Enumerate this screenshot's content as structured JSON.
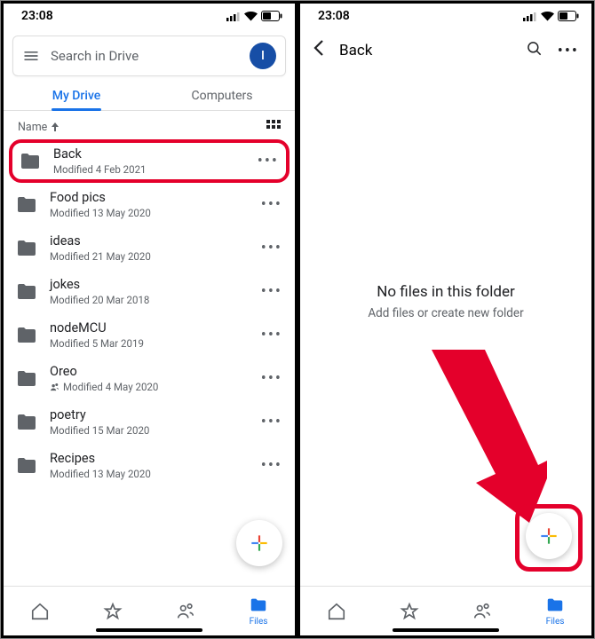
{
  "status": {
    "time": "23:08"
  },
  "left": {
    "search_placeholder": "Search in Drive",
    "avatar_initial": "I",
    "tabs": {
      "my_drive": "My Drive",
      "computers": "Computers"
    },
    "sort_label": "Name",
    "items": [
      {
        "name": "Back",
        "meta": "Modified 4 Feb 2021",
        "shared": false,
        "highlight": true
      },
      {
        "name": "Food pics",
        "meta": "Modified 13 May 2020",
        "shared": false
      },
      {
        "name": "ideas",
        "meta": "Modified 21 May 2020",
        "shared": false
      },
      {
        "name": "jokes",
        "meta": "Modified 20 Mar 2018",
        "shared": false
      },
      {
        "name": "nodeMCU",
        "meta": "Modified 5 Mar 2019",
        "shared": false
      },
      {
        "name": "Oreo",
        "meta": "Modified 4 May 2020",
        "shared": true
      },
      {
        "name": "poetry",
        "meta": "Modified 15 Mar 2020",
        "shared": false
      },
      {
        "name": "Recipes",
        "meta": "Modified 13 May 2020",
        "shared": false
      }
    ]
  },
  "right": {
    "title": "Back",
    "empty_line1": "No files in this folder",
    "empty_line2": "Add files or create new folder"
  },
  "bottomnav": {
    "files_label": "Files"
  }
}
